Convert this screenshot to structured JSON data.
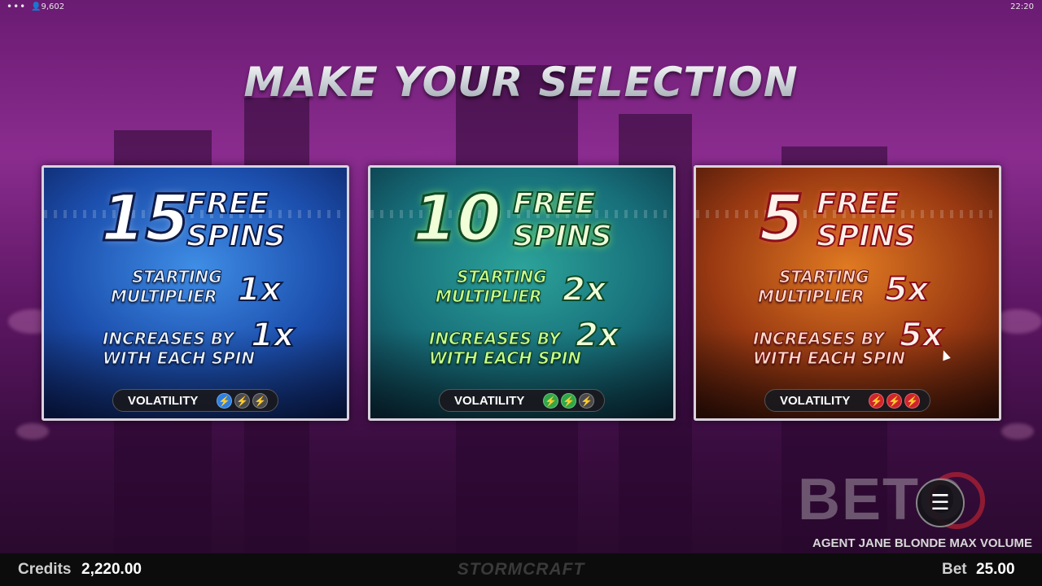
{
  "topbar": {
    "menu_icon": "more-dots-icon",
    "players_icon": "person-icon",
    "player_count": "9,602",
    "time": "22:20"
  },
  "title": "MAKE YOUR SELECTION",
  "options": [
    {
      "spins": "15",
      "free_label": "FREE",
      "spins_label": "SPINS",
      "starting_label_1": "STARTING",
      "starting_label_2": "MULTIPLIER",
      "starting_value": "1x",
      "increase_label_1": "INCREASES BY",
      "increase_value": "1x",
      "increase_label_2": "WITH EACH SPIN",
      "volatility_label": "VOLATILITY",
      "volatility_level": 1,
      "color": "#2f7fe0"
    },
    {
      "spins": "10",
      "free_label": "FREE",
      "spins_label": "SPINS",
      "starting_label_1": "STARTING",
      "starting_label_2": "MULTIPLIER",
      "starting_value": "2x",
      "increase_label_1": "INCREASES BY",
      "increase_value": "2x",
      "increase_label_2": "WITH EACH SPIN",
      "volatility_label": "VOLATILITY",
      "volatility_level": 2,
      "color": "#2fa84a"
    },
    {
      "spins": "5",
      "free_label": "FREE",
      "spins_label": "SPINS",
      "starting_label_1": "STARTING",
      "starting_label_2": "MULTIPLIER",
      "starting_value": "5x",
      "increase_label_1": "INCREASES BY",
      "increase_value": "5x",
      "increase_label_2": "WITH EACH SPIN",
      "volatility_label": "VOLATILITY",
      "volatility_level": 3,
      "color": "#d0242c"
    }
  ],
  "watermark": "BETO",
  "game_name": "AGENT JANE BLONDE MAX VOLUME",
  "menu_button_icon": "hamburger-menu-icon",
  "bottombar": {
    "credits_label": "Credits",
    "credits_value": "2,220.00",
    "brand": "STORMCRAFT",
    "bet_label": "Bet",
    "bet_value": "25.00"
  }
}
